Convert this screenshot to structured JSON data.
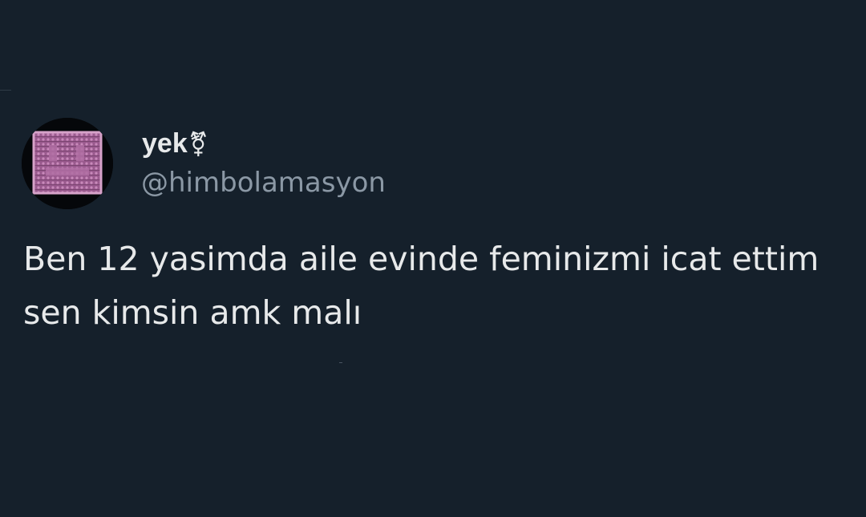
{
  "tweet": {
    "author": {
      "display_name": "yek",
      "badge_glyph": "⚧",
      "handle": "@himbolamasyon",
      "avatar_icon": "knitted-square-avatar"
    },
    "text": "Ben 12 yasimda aile evinde feminizmi icat ettim sen kimsin amk malı"
  },
  "colors": {
    "background": "#15202b",
    "primary_text": "#e7e9ea",
    "secondary_text": "#8b98a5",
    "avatar_accent": "#c87fb4"
  }
}
